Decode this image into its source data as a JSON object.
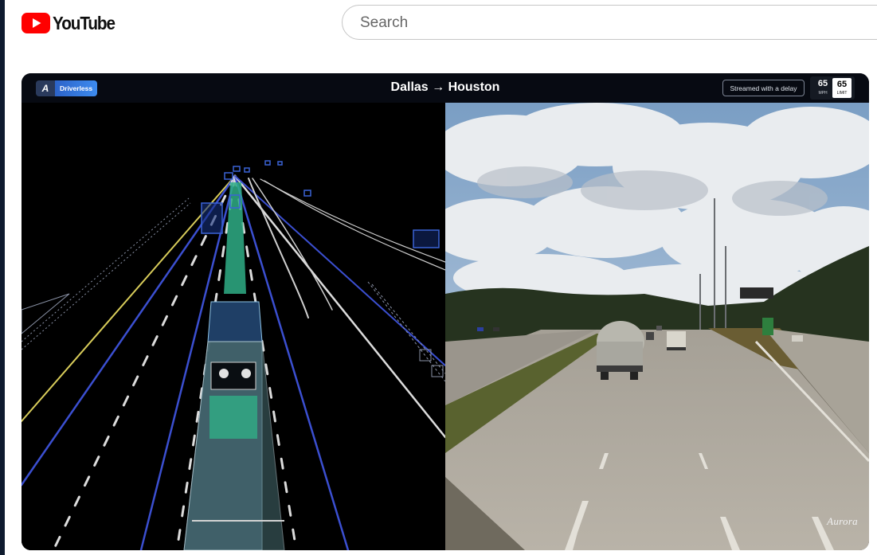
{
  "header": {
    "logo_text": "YouTube",
    "search_placeholder": "Search"
  },
  "player": {
    "badge_label": "Driverless",
    "title": "Dallas → Houston",
    "stream_status": "Streamed with a delay",
    "speed": {
      "value": "65",
      "unit": "MPH"
    },
    "speed_limit": {
      "value": "65",
      "unit": "LIMIT"
    },
    "watermark": "Aurora"
  },
  "colors": {
    "page_border": "#0f1b2f",
    "youtube_red": "#ff0000",
    "badge_blue": "#3d8bee",
    "lidar_blue": "#3a63d6",
    "lane_green": "#2fae86"
  }
}
